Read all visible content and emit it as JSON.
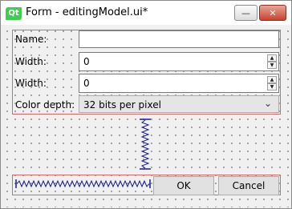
{
  "window": {
    "title": "Form - editingModel.ui*",
    "logo_text": "Qt"
  },
  "title_buttons": {
    "minimize": "—",
    "close": "✕"
  },
  "form": {
    "name": {
      "label": "Name:",
      "value": ""
    },
    "width1": {
      "label": "Width:",
      "value": "0"
    },
    "width2": {
      "label": "Width:",
      "value": "0"
    },
    "color_depth": {
      "label": "Color depth:",
      "value": "32 bits per pixel"
    }
  },
  "spin_arrows": {
    "up": "▲",
    "down": "▼"
  },
  "combo_arrow": "⌄",
  "buttons": {
    "ok": "OK",
    "cancel": "Cancel"
  }
}
